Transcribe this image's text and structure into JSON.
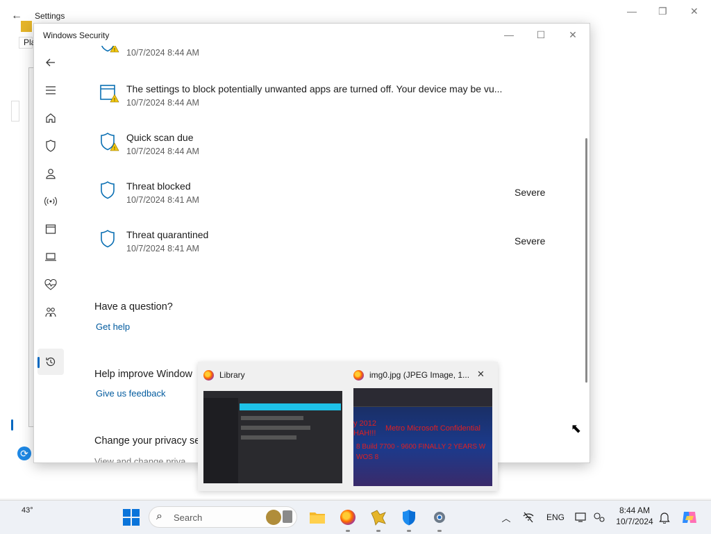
{
  "background_window": {
    "title": "Settings",
    "partial_label": "Pla"
  },
  "window": {
    "title": "Windows Security",
    "controls": {
      "minimize": "—",
      "maximize": "☐",
      "close": "✕"
    }
  },
  "nav": {
    "items": [
      "back",
      "menu",
      "home",
      "virus-protection",
      "account-protection",
      "firewall",
      "app-browser-control",
      "device-security",
      "device-performance",
      "family-options",
      "protection-history",
      "settings"
    ],
    "active": "protection-history"
  },
  "history": {
    "items": [
      {
        "title": "",
        "time": "10/7/2024 8:44 AM",
        "severity": "",
        "icon": "shield-warning"
      },
      {
        "title": "The settings to block potentially unwanted apps are turned off. Your device may be vu...",
        "time": "10/7/2024 8:44 AM",
        "severity": "",
        "icon": "app-warning"
      },
      {
        "title": "Quick scan due",
        "time": "10/7/2024 8:44 AM",
        "severity": "",
        "icon": "shield-warning"
      },
      {
        "title": "Threat blocked",
        "time": "10/7/2024 8:41 AM",
        "severity": "Severe",
        "icon": "shield"
      },
      {
        "title": "Threat quarantined",
        "time": "10/7/2024 8:41 AM",
        "severity": "Severe",
        "icon": "shield"
      }
    ]
  },
  "question": {
    "heading": "Have a question?",
    "link": "Get help"
  },
  "improve": {
    "heading": "Help improve Window",
    "link": "Give us feedback"
  },
  "privacy": {
    "heading": "Change your privacy se",
    "sub": "View and change priva"
  },
  "previews": [
    {
      "title": "Library",
      "app": "Firefox"
    },
    {
      "title": "img0.jpg (JPEG Image, 1...",
      "app": "Firefox",
      "close": "✕",
      "image_text": [
        "y 2012",
        "HAH!!!",
        "Metro Microsoft Confidential",
        "8 Build 7700 - 9600 FINALLY 2 YEARS W",
        "WOS 8"
      ]
    }
  ],
  "taskbar": {
    "weather": "43°",
    "search_label": "Search",
    "language": "ENG",
    "time": "8:44 AM",
    "date": "10/7/2024",
    "pinned": [
      "start",
      "search",
      "file-explorer",
      "firefox",
      "app",
      "windows-security",
      "settings"
    ]
  },
  "colors": {
    "accent": "#0067c0",
    "link": "#005a9e",
    "shield": "#0a6fb3",
    "warning": "#f2c811"
  }
}
